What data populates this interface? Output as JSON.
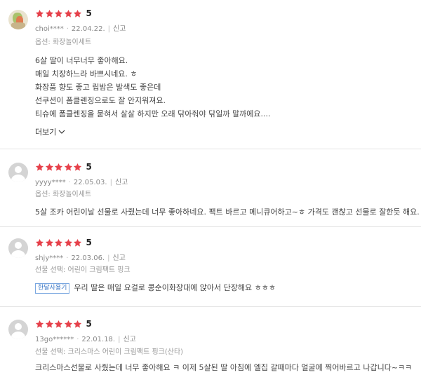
{
  "star_color": "#e6404a",
  "reviews": [
    {
      "avatar": "photo-avatar",
      "score": "5",
      "user": "choi****",
      "date": "22.04.22.",
      "report": "신고",
      "option": "옵션: 화장놀이세트",
      "lines": [
        "6살 딸이 너무너무 좋아해요.",
        "매일 치장하느라 바쁘시네요. ㅎ",
        "화장품 향도 좋고 립밤은 발색도 좋은데",
        "선쿠션이 폼클렌징으로도 잘 안지워져요.",
        "티슈에 폼클렌징을 묻혀서 살살 하지만 오래 닦아줘야 닦일까 말까에요...."
      ],
      "more": "더보기"
    },
    {
      "avatar": "default-avatar",
      "score": "5",
      "user": "yyyy****",
      "date": "22.05.03.",
      "report": "신고",
      "option": "옵션: 화장놀이세트",
      "lines": [
        "5살 조카 어린이날 선물로 사줬는데 너무 좋아하네요. 팩트 바르고 메니큐어하고~ㅎ 가격도 괜찮고 선물로 잘한듯 해요."
      ]
    },
    {
      "avatar": "default-avatar",
      "score": "5",
      "user": "shjy****",
      "date": "22.03.06.",
      "report": "신고",
      "option": "선물 선택: 어린이 크림팩트 핑크",
      "badge": "한달사용기",
      "lines": [
        "우리 딸은 매일 요걸로 콩순이화장대에 앉아서 단장해요 ㅎㅎㅎ"
      ]
    },
    {
      "avatar": "default-avatar",
      "score": "5",
      "user": "13go******",
      "date": "22.01.18.",
      "report": "신고",
      "option": "선물 선택: 크리스마스 어린이 크림팩트 핑크(산타)",
      "lines": [
        "크리스마스선물로 사줬는데 너무 좋아해요 ㅋ 이제 5살된 딸 아침에 엘집 갈때마다 얼굴에 찍어바르고 나갑니다~ㅋㅋ"
      ]
    }
  ]
}
